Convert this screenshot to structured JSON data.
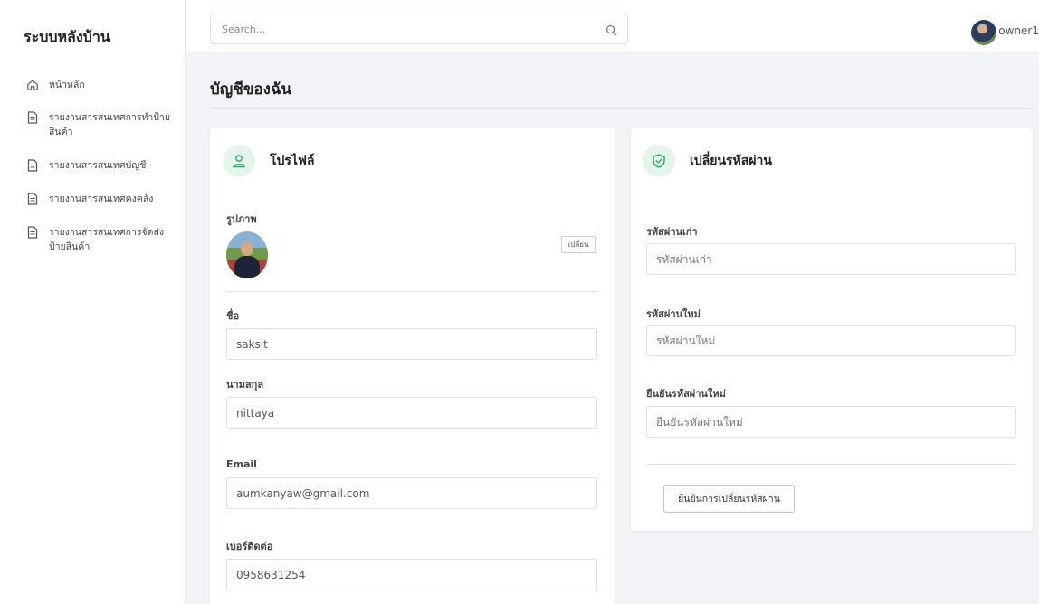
{
  "app": {
    "brand": "ระบบหลังบ้าน"
  },
  "sidebar": {
    "items": [
      {
        "label": "หน้าหลัก",
        "icon": "home-icon"
      },
      {
        "label": "รายงานสารสนเทศการทำป้ายสินค้า",
        "icon": "document-icon"
      },
      {
        "label": "รายงานสารสนเทศบัญชี",
        "icon": "document-icon"
      },
      {
        "label": "รายงานสารสนเทศคงคลัง",
        "icon": "document-icon"
      },
      {
        "label": "รายงานสารสนเทศการจัดส่งป้ายสินค้า",
        "icon": "document-icon"
      }
    ]
  },
  "header": {
    "search_placeholder": "Search...",
    "search_icon": "search-icon",
    "username": "owner1"
  },
  "page": {
    "title": "บัญชีของฉัน"
  },
  "profile": {
    "title": "โปรไฟล์",
    "icon": "user-icon",
    "photo_label": "รูปภาพ",
    "change_label": "เปลี่ยน",
    "first_name_label": "ชื่อ",
    "first_name": "saksit",
    "last_name_label": "นามสกุล",
    "last_name": "nittaya",
    "email_label": "Email",
    "email": "aumkanyaw@gmail.com",
    "phone_label": "เบอร์ติดต่อ",
    "phone": "0958631254"
  },
  "password": {
    "title": "เปลี่ยนรหัสผ่าน",
    "icon": "shield-check-icon",
    "old_label": "รหัสผ่านเก่า",
    "old_placeholder": "รหัสผ่านเก่า",
    "new_label": "รหัสผ่านใหม่",
    "new_placeholder": "รหัสผ่านใหม่",
    "confirm_label": "ยืนยันรหัสผ่านใหม่",
    "confirm_placeholder": "ยืนยันรหัสผ่านใหม่",
    "submit_label": "ยืนยันการเปลี่ยนรหัสผ่าน"
  },
  "colors": {
    "accent": "#2fa56a",
    "accent_bg": "#e6f5ec",
    "page_bg": "#f1f3f7"
  }
}
